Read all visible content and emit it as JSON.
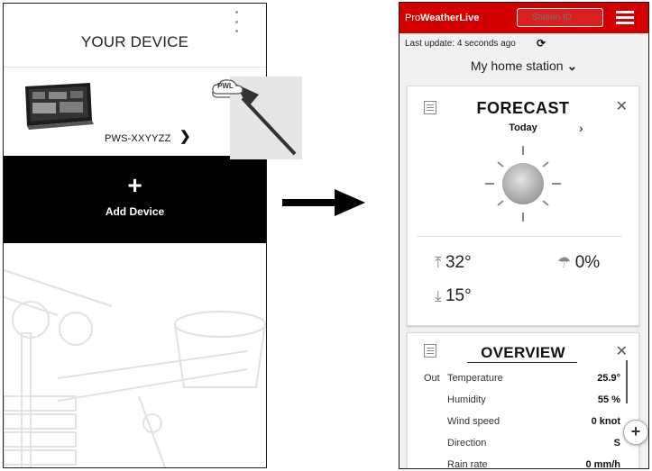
{
  "left_screen": {
    "title": "YOUR DEVICE",
    "device": {
      "name": "PWS-XXYYZZ",
      "cloud_badge": "PWL",
      "icon": "weather-station-display"
    },
    "add_device": {
      "icon": "+",
      "label": "Add Device"
    }
  },
  "right_screen": {
    "brand_pro": "Pro",
    "brand_name": "WeatherLive",
    "station_id_placeholder": "Station ID",
    "last_update": "Last update: 4 seconds ago",
    "station_name": "My home station",
    "station_chevron": "⌄",
    "forecast": {
      "title": "FORECAST",
      "day": "Today",
      "next": "›",
      "close": "✕",
      "high": "32°",
      "low": "15°",
      "rain": "0%",
      "icons": {
        "high": "arrow-up-icon",
        "low": "arrow-down-icon",
        "rain": "umbrella-icon",
        "weather": "sun-icon"
      }
    },
    "overview": {
      "title": "OVERVIEW",
      "close": "✕",
      "group": "Out",
      "rows": [
        {
          "label": "Temperature",
          "value": "25.9°"
        },
        {
          "label": "Humidity",
          "value": "55 %"
        },
        {
          "label": "Wind speed",
          "value": "0 knot"
        },
        {
          "label": "Direction",
          "value": "S"
        },
        {
          "label": "Rain rate",
          "value": "0 mm/h"
        }
      ]
    },
    "fab": "+"
  },
  "colors": {
    "brand_red": "#d40000",
    "black": "#000000",
    "white": "#ffffff"
  }
}
